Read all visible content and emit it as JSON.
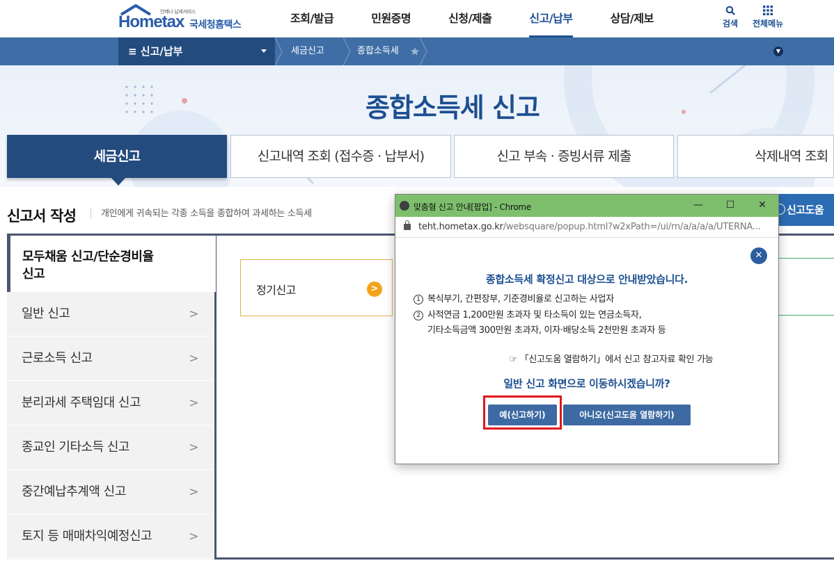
{
  "header": {
    "logo_word": "Hometax",
    "logo_tagline": "언제나 납세서비스",
    "logo_name": "국세청홈택스",
    "nav": [
      "조회/발급",
      "민원증명",
      "신청/제출",
      "신고/납부",
      "상담/제보"
    ],
    "active_nav": "신고/납부",
    "search_label": "검색",
    "all_menu_label": "전체메뉴"
  },
  "subnav": {
    "menu_label": "≡ 신고/납부",
    "crumbs": [
      "세금신고",
      "종합소득세"
    ]
  },
  "banner": {
    "title": "종합소득세 신고"
  },
  "tabs": [
    "세금신고",
    "신고내역 조회 (접수증 · 납부서)",
    "신고 부속 · 증빙서류 제출",
    "삭제내역 조회"
  ],
  "section": {
    "title": "신고서 작성",
    "description": "개인에게 귀속되는 각종 소득을 종합하여 과세하는 소득세"
  },
  "side_menu": {
    "active_line1": "모두채움 신고/단순경비율",
    "active_line2": "신고",
    "items": [
      "일반 신고",
      "근로소득 신고",
      "분리과세 주택임대 신고",
      "종교인 기타소득 신고",
      "중간예납추계액 신고",
      "토지 등 매매차익예정신고"
    ]
  },
  "content": {
    "card_label": "정기신고",
    "help_button": "신고도움"
  },
  "popup": {
    "window_title": "맞춤형 신고 안내[팝업] - Chrome",
    "url_host": "teht.hometax.go.kr",
    "url_path": "/websquare/popup.html?w2xPath=/ui/rn/a/a/a/a/UTERNA...",
    "heading": "종합소득세 확정신고 대상으로 안내받았습니다.",
    "line1_num": "1",
    "line1": "복식부기, 간편장부, 기준경비율로 신고하는 사업자",
    "line2_num": "2",
    "line2": "사적연금 1,200만원 초과자 및 타소득이 있는 연금소득자,",
    "line3": "기타소득금액 300만원 초과자, 이자·배당소득 2천만원 초과자 등",
    "note": "☞ 「신고도움 열람하기」에서 신고 참고자료 확인 가능",
    "question": "일반 신고 화면으로 이동하시겠습니까?",
    "yes_button": "예(신고하기)",
    "no_button": "아니오(신고도움 열람하기)"
  },
  "colors": {
    "brand_blue": "#1d4f91",
    "subnav": "#3f6ea6",
    "popup_titlebar": "#7dbf6d",
    "highlight": "#e0171b",
    "accent_orange": "#f3a31b"
  }
}
